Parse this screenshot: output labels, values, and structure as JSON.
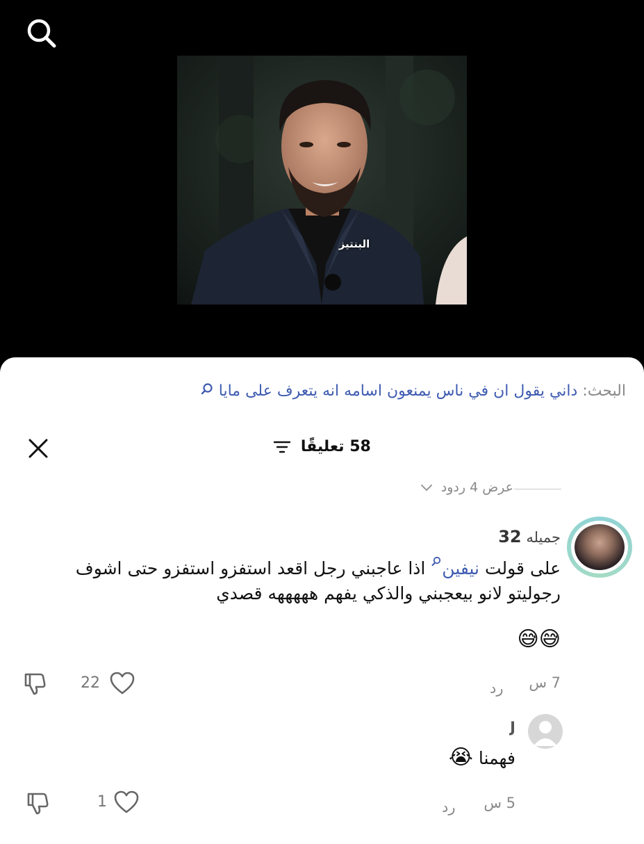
{
  "video": {
    "watermark": "البنتيز"
  },
  "search": {
    "prefix": "البحث:",
    "query": "داني يقول ان في ناس يمنعون اسامه انه يتعرف على مايا"
  },
  "comments_header": {
    "count_label": "58 تعليقًا"
  },
  "view_replies": {
    "label": "عرض 4 ردود"
  },
  "comment": {
    "username": "جميله",
    "username_num": "32",
    "text_before_mention": "على قولت ",
    "mention": "نيفين",
    "text_after_mention": " اذا عاجبني رجل اقعد استفزو استفزو حتى اشوف رجوليتو لانو بيعجبني والذكي يفهم هههههه قصدي",
    "emojis": "😅😅",
    "time": "7 س",
    "reply_label": "رد",
    "likes": "22"
  },
  "reply": {
    "username": "J",
    "text": "فهمنا",
    "emoji": "😭",
    "time": "5 س",
    "reply_label": "رد",
    "likes": "1"
  },
  "colors": {
    "background_video": "#000000",
    "sheet": "#ffffff",
    "link_blue": "#3e5bb0",
    "muted_gray": "#888888"
  },
  "icons": [
    "search-icon",
    "filter-icon",
    "close-icon",
    "chevron-down-icon",
    "heart-icon",
    "dislike-icon",
    "magnifier-small-icon"
  ]
}
